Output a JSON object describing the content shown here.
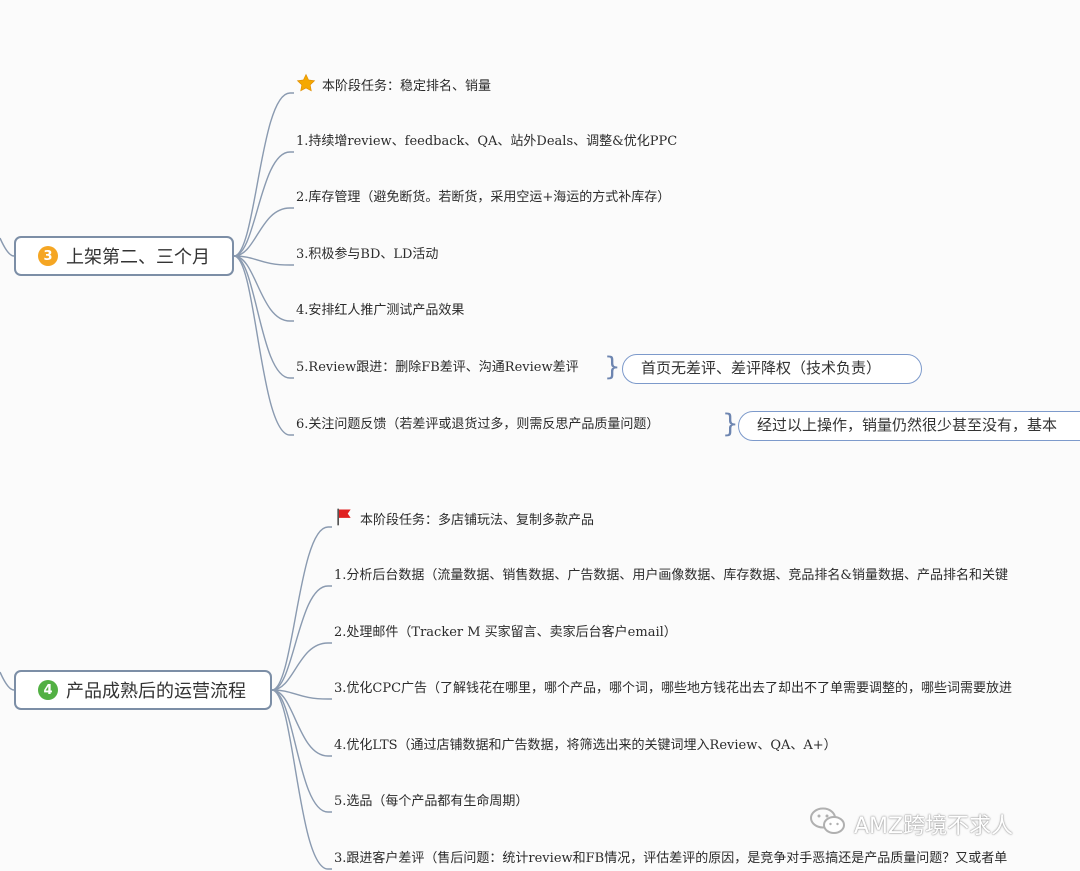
{
  "colors": {
    "line": "#8a9ab0",
    "badge3": "#f5a623",
    "badge4": "#52b043",
    "star": "#f5a800",
    "flag": "#e02020"
  },
  "section3": {
    "badge": "3",
    "title": "上架第二、三个月",
    "items": [
      {
        "text": "本阶段任务：稳定排名、销量",
        "icon": "star-icon"
      },
      {
        "text": "1.持续增review、feedback、QA、站外Deals、调整&优化PPC"
      },
      {
        "text": "2.库存管理（避免断货。若断货，采用空运+海运的方式补库存）"
      },
      {
        "text": "3.积极参与BD、LD活动"
      },
      {
        "text": "4.安排红人推广测试产品效果"
      },
      {
        "text": "5.Review跟进：删除FB差评、沟通Review差评"
      },
      {
        "text": "6.关注问题反馈（若差评或退货过多，则需反思产品质量问题）"
      }
    ],
    "callouts": [
      {
        "text": "首页无差评、差评降权（技术负责）"
      },
      {
        "text": "经过以上操作，销量仍然很少甚至没有，基本"
      }
    ]
  },
  "section4": {
    "badge": "4",
    "title": "产品成熟后的运营流程",
    "items": [
      {
        "text": "本阶段任务：多店铺玩法、复制多款产品",
        "icon": "flag-icon"
      },
      {
        "text": "1.分析后台数据（流量数据、销售数据、广告数据、用户画像数据、库存数据、竞品排名&销量数据、产品排名和关键"
      },
      {
        "text": "2.处理邮件（Tracker M 买家留言、卖家后台客户email）"
      },
      {
        "text": "3.优化CPC广告（了解钱花在哪里，哪个产品，哪个词，哪些地方钱花出去了却出不了单需要调整的，哪些词需要放进"
      },
      {
        "text": "4.优化LTS（通过店铺数据和广告数据，将筛选出来的关键词埋入Review、QA、A+）"
      },
      {
        "text": "5.选品（每个产品都有生命周期）"
      },
      {
        "text": "3.跟进客户差评（售后问题：统计review和FB情况，评估差评的原因，是竞争对手恶搞还是产品质量问题？又或者单"
      }
    ]
  },
  "watermark": {
    "text": "AMZ跨境不求人",
    "icon": "wechat-icon"
  }
}
